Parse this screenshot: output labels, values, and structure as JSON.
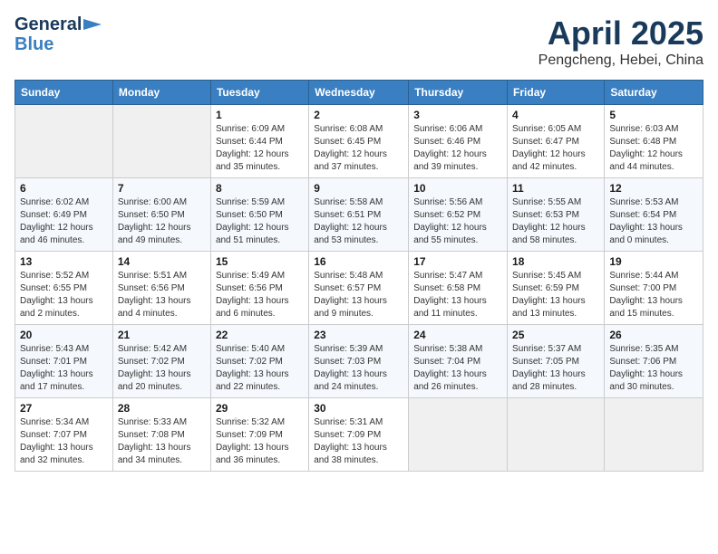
{
  "logo": {
    "line1": "General",
    "line2": "Blue"
  },
  "title": "April 2025",
  "subtitle": "Pengcheng, Hebei, China",
  "headers": [
    "Sunday",
    "Monday",
    "Tuesday",
    "Wednesday",
    "Thursday",
    "Friday",
    "Saturday"
  ],
  "weeks": [
    [
      {
        "num": "",
        "info": ""
      },
      {
        "num": "",
        "info": ""
      },
      {
        "num": "1",
        "info": "Sunrise: 6:09 AM\nSunset: 6:44 PM\nDaylight: 12 hours and 35 minutes."
      },
      {
        "num": "2",
        "info": "Sunrise: 6:08 AM\nSunset: 6:45 PM\nDaylight: 12 hours and 37 minutes."
      },
      {
        "num": "3",
        "info": "Sunrise: 6:06 AM\nSunset: 6:46 PM\nDaylight: 12 hours and 39 minutes."
      },
      {
        "num": "4",
        "info": "Sunrise: 6:05 AM\nSunset: 6:47 PM\nDaylight: 12 hours and 42 minutes."
      },
      {
        "num": "5",
        "info": "Sunrise: 6:03 AM\nSunset: 6:48 PM\nDaylight: 12 hours and 44 minutes."
      }
    ],
    [
      {
        "num": "6",
        "info": "Sunrise: 6:02 AM\nSunset: 6:49 PM\nDaylight: 12 hours and 46 minutes."
      },
      {
        "num": "7",
        "info": "Sunrise: 6:00 AM\nSunset: 6:50 PM\nDaylight: 12 hours and 49 minutes."
      },
      {
        "num": "8",
        "info": "Sunrise: 5:59 AM\nSunset: 6:50 PM\nDaylight: 12 hours and 51 minutes."
      },
      {
        "num": "9",
        "info": "Sunrise: 5:58 AM\nSunset: 6:51 PM\nDaylight: 12 hours and 53 minutes."
      },
      {
        "num": "10",
        "info": "Sunrise: 5:56 AM\nSunset: 6:52 PM\nDaylight: 12 hours and 55 minutes."
      },
      {
        "num": "11",
        "info": "Sunrise: 5:55 AM\nSunset: 6:53 PM\nDaylight: 12 hours and 58 minutes."
      },
      {
        "num": "12",
        "info": "Sunrise: 5:53 AM\nSunset: 6:54 PM\nDaylight: 13 hours and 0 minutes."
      }
    ],
    [
      {
        "num": "13",
        "info": "Sunrise: 5:52 AM\nSunset: 6:55 PM\nDaylight: 13 hours and 2 minutes."
      },
      {
        "num": "14",
        "info": "Sunrise: 5:51 AM\nSunset: 6:56 PM\nDaylight: 13 hours and 4 minutes."
      },
      {
        "num": "15",
        "info": "Sunrise: 5:49 AM\nSunset: 6:56 PM\nDaylight: 13 hours and 6 minutes."
      },
      {
        "num": "16",
        "info": "Sunrise: 5:48 AM\nSunset: 6:57 PM\nDaylight: 13 hours and 9 minutes."
      },
      {
        "num": "17",
        "info": "Sunrise: 5:47 AM\nSunset: 6:58 PM\nDaylight: 13 hours and 11 minutes."
      },
      {
        "num": "18",
        "info": "Sunrise: 5:45 AM\nSunset: 6:59 PM\nDaylight: 13 hours and 13 minutes."
      },
      {
        "num": "19",
        "info": "Sunrise: 5:44 AM\nSunset: 7:00 PM\nDaylight: 13 hours and 15 minutes."
      }
    ],
    [
      {
        "num": "20",
        "info": "Sunrise: 5:43 AM\nSunset: 7:01 PM\nDaylight: 13 hours and 17 minutes."
      },
      {
        "num": "21",
        "info": "Sunrise: 5:42 AM\nSunset: 7:02 PM\nDaylight: 13 hours and 20 minutes."
      },
      {
        "num": "22",
        "info": "Sunrise: 5:40 AM\nSunset: 7:02 PM\nDaylight: 13 hours and 22 minutes."
      },
      {
        "num": "23",
        "info": "Sunrise: 5:39 AM\nSunset: 7:03 PM\nDaylight: 13 hours and 24 minutes."
      },
      {
        "num": "24",
        "info": "Sunrise: 5:38 AM\nSunset: 7:04 PM\nDaylight: 13 hours and 26 minutes."
      },
      {
        "num": "25",
        "info": "Sunrise: 5:37 AM\nSunset: 7:05 PM\nDaylight: 13 hours and 28 minutes."
      },
      {
        "num": "26",
        "info": "Sunrise: 5:35 AM\nSunset: 7:06 PM\nDaylight: 13 hours and 30 minutes."
      }
    ],
    [
      {
        "num": "27",
        "info": "Sunrise: 5:34 AM\nSunset: 7:07 PM\nDaylight: 13 hours and 32 minutes."
      },
      {
        "num": "28",
        "info": "Sunrise: 5:33 AM\nSunset: 7:08 PM\nDaylight: 13 hours and 34 minutes."
      },
      {
        "num": "29",
        "info": "Sunrise: 5:32 AM\nSunset: 7:09 PM\nDaylight: 13 hours and 36 minutes."
      },
      {
        "num": "30",
        "info": "Sunrise: 5:31 AM\nSunset: 7:09 PM\nDaylight: 13 hours and 38 minutes."
      },
      {
        "num": "",
        "info": ""
      },
      {
        "num": "",
        "info": ""
      },
      {
        "num": "",
        "info": ""
      }
    ]
  ]
}
